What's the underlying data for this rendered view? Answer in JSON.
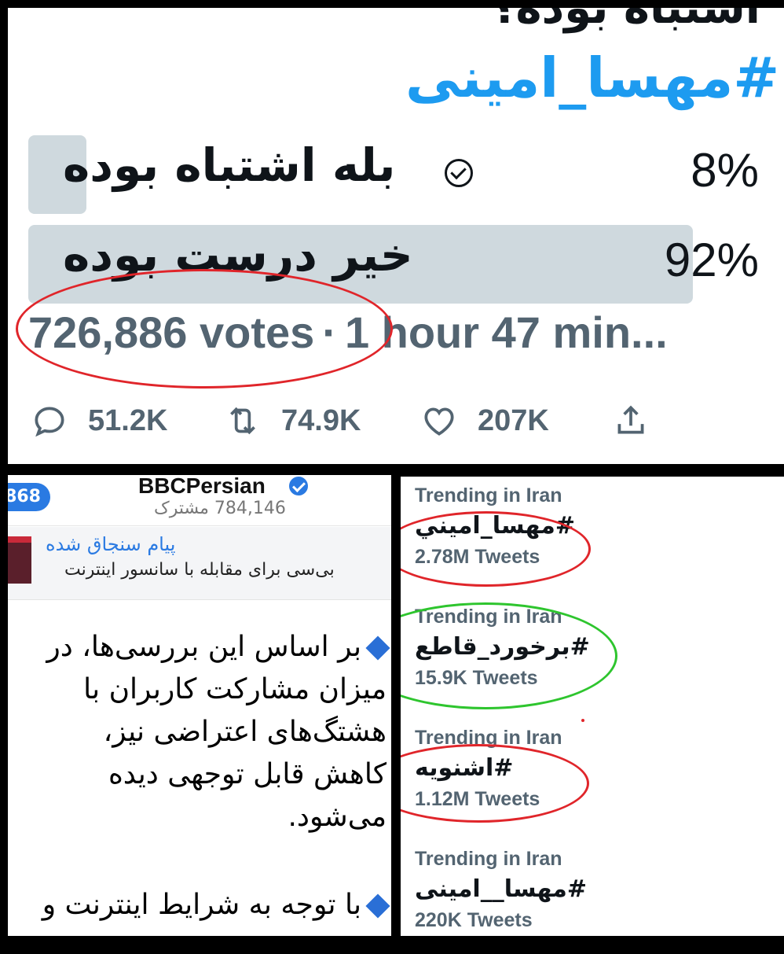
{
  "poll": {
    "cut_text": "اشتباه بوده؟",
    "hashtag": "#مهسا_امینی",
    "options": [
      {
        "label": "بله اشتباه بوده",
        "percent_text": "8%",
        "percent": 8,
        "selected": true
      },
      {
        "label": "خیر درست بوده",
        "percent_text": "92%",
        "percent": 92,
        "selected": false
      }
    ],
    "votes": "726,886 votes",
    "separator": "·",
    "time_left": "1 hour 47 min...",
    "actions": {
      "replies": "51.2K",
      "retweets": "74.9K",
      "likes": "207K"
    },
    "icons": [
      "reply-icon",
      "retweet-icon",
      "like-icon",
      "share-icon"
    ]
  },
  "bbc": {
    "badge": "868",
    "name": "BBCPersian",
    "subscribers": "784,146 مشترک",
    "pinned_title": "پیام سنجاق شده",
    "pinned_text": "بی‌سی برای مقابله با سانسور اینترنت",
    "paragraph1": [
      "بر اساس این بررسی‌ها، در",
      "میزان مشارکت کاربران با",
      "هشتگ‌های اعتراضی نیز،",
      "کاهش قابل توجهی دیده",
      "می‌شود."
    ],
    "paragraph2": [
      "با توجه به شرایط اینترنت و"
    ]
  },
  "trending": [
    {
      "label": "Trending in Iran",
      "tag": "#مهسا_اميني",
      "count": "2.78M Tweets"
    },
    {
      "label": "Trending in Iran",
      "tag": "#برخورد_قاطع",
      "count": "15.9K Tweets"
    },
    {
      "label": "Trending in Iran",
      "tag": "#اشنويه",
      "count": "1.12M Tweets"
    },
    {
      "label": "Trending in Iran",
      "tag": "#مهسا__امینی",
      "count": "220K Tweets"
    }
  ],
  "colors": {
    "accent": "#1d9bf0",
    "highlight_red": "#e0252a",
    "highlight_green": "#2ec52e",
    "poll_fill": "#cfd9de"
  }
}
